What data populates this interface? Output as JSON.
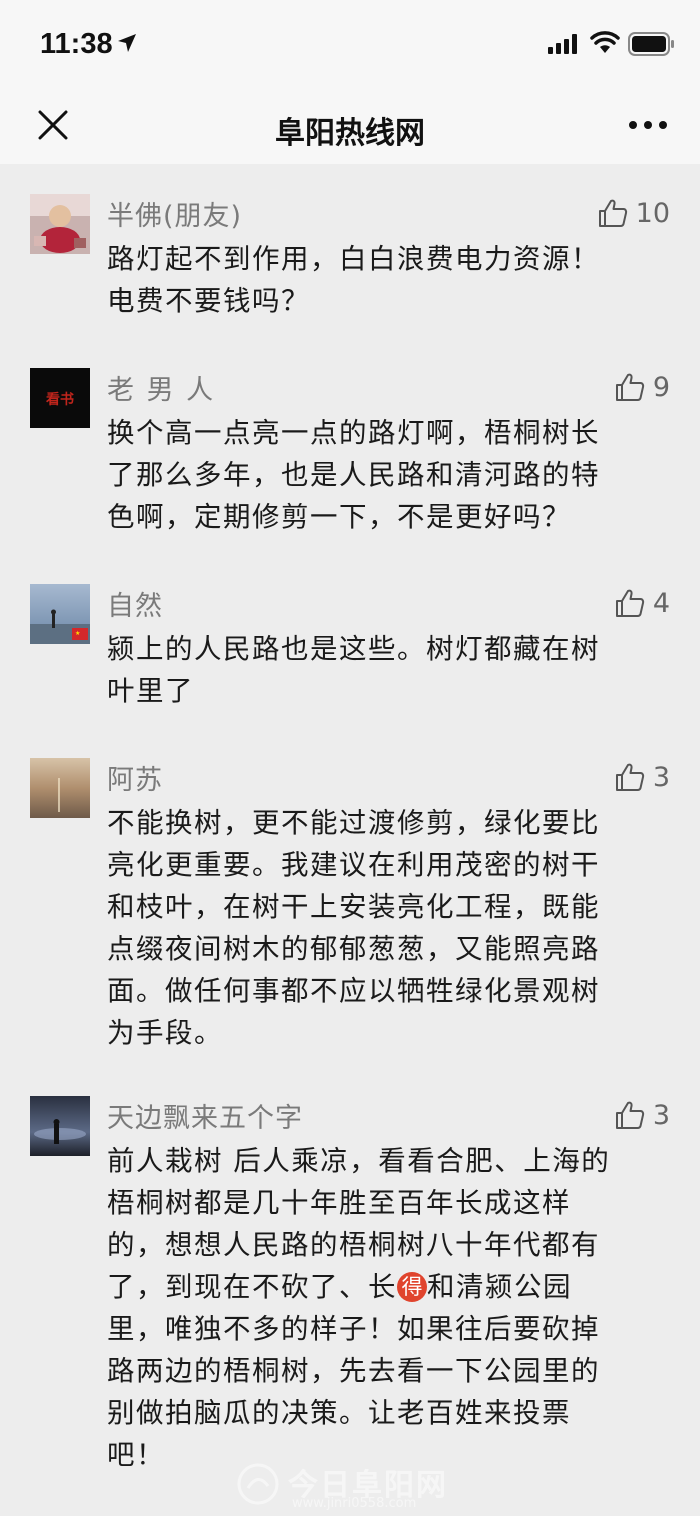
{
  "status_bar": {
    "time": "11:38"
  },
  "nav": {
    "title": "阜阳热线网"
  },
  "comments": [
    {
      "name": "半佛(朋友)",
      "likes": "10",
      "lines": [
        "路灯起不到作用，白白浪费电力资源！",
        "电费不要钱吗？"
      ]
    },
    {
      "name": "老 男 人",
      "likes": "9",
      "avatar_text": "看书",
      "lines": [
        "换个高一点亮一点的路灯啊，梧桐树长",
        "了那么多年，也是人民路和清河路的特",
        "色啊，定期修剪一下，不是更好吗？"
      ]
    },
    {
      "name": "自然",
      "likes": "4",
      "lines": [
        "颍上的人民路也是这些。树灯都藏在树",
        "叶里了"
      ]
    },
    {
      "name": "阿苏",
      "likes": "3",
      "lines": [
        "不能换树，更不能过渡修剪，绿化要比",
        "亮化更重要。我建议在利用茂密的树干",
        "和枝叶，在树干上安装亮化工程，既能",
        "点缀夜间树木的郁郁葱葱，又能照亮路",
        "面。做任何事都不应以牺牲绿化景观树",
        "为手段。"
      ]
    },
    {
      "name": "天边飘来五个字",
      "likes": "3",
      "lines": [
        "前人栽树 后人乘凉，看看合肥、上海的",
        "梧桐树都是几十年胜至百年长成这样",
        "的，想想人民路的梧桐树八十年代都有"
      ],
      "line4_a": "了，到现在不砍了、长",
      "line4_emoji": "得",
      "line4_b": "和清颍公园",
      "lines_rest": [
        "里，唯独不多的样子！如果往后要砍掉",
        "路两边的梧桐树，先去看一下公园里的",
        "别做拍脑瓜的决策。让老百姓来投票",
        "吧！"
      ]
    }
  ],
  "watermark": {
    "text": "今日阜阳网",
    "url": "www.jinri0558.com"
  },
  "icons": {
    "location": "location-arrow-icon",
    "signal": "cellular-signal-icon",
    "wifi": "wifi-icon",
    "battery": "battery-icon",
    "close": "close-icon",
    "more": "more-icon",
    "like": "thumbs-up-icon"
  }
}
